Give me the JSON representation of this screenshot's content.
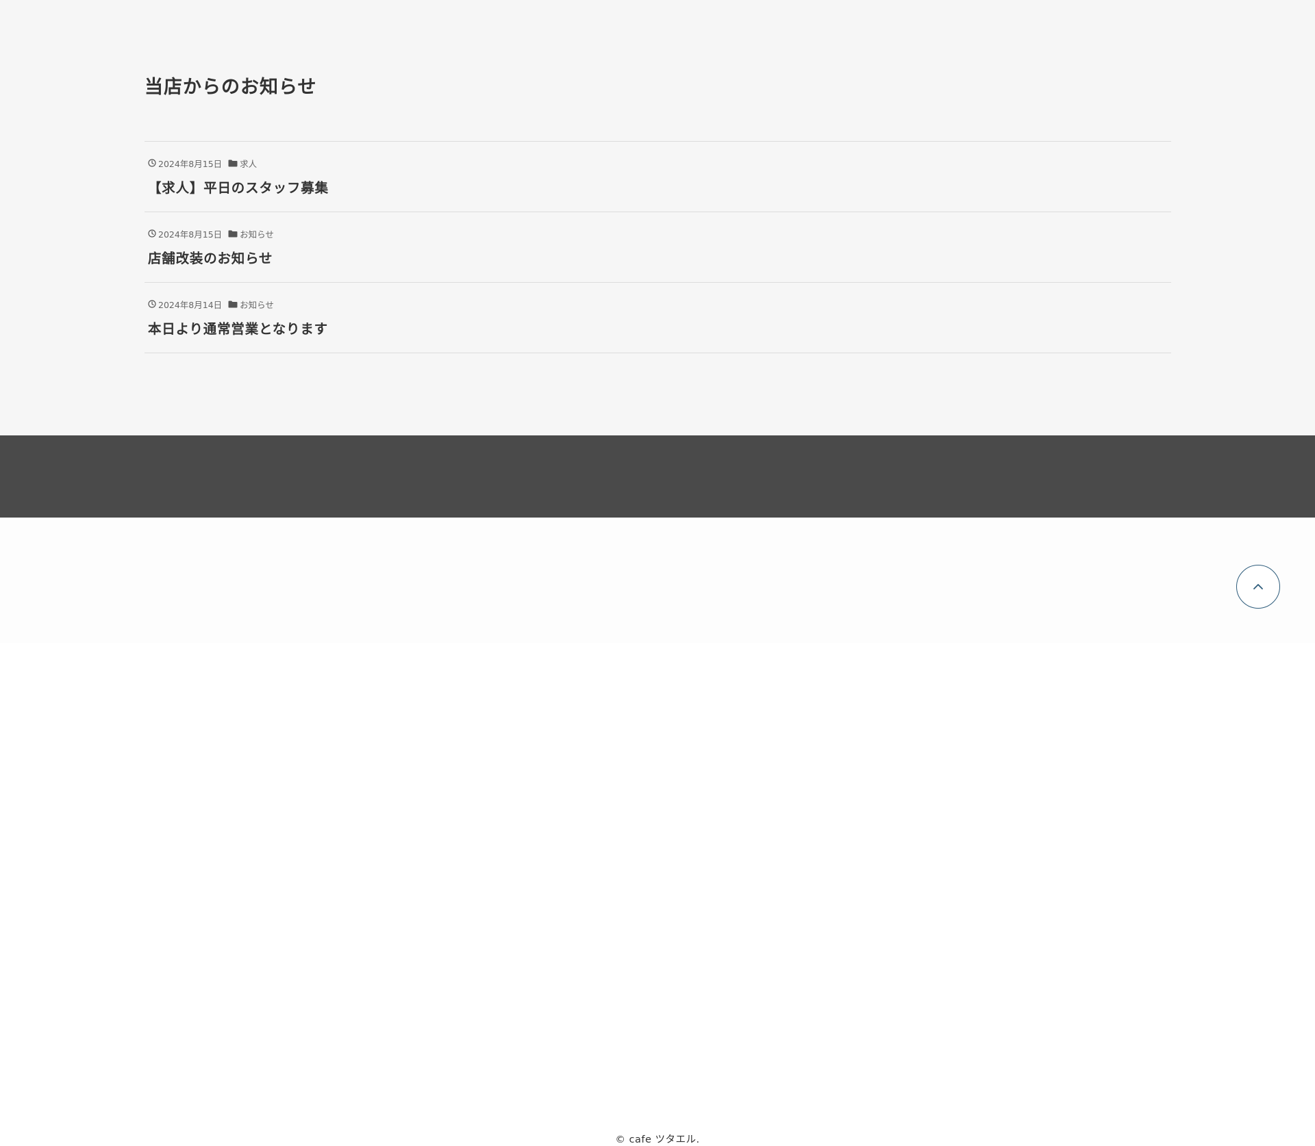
{
  "news": {
    "title": "当店からのお知らせ",
    "items": [
      {
        "date": "2024年8月15日",
        "category": "求人",
        "title": "【求人】平日のスタッフ募集"
      },
      {
        "date": "2024年8月15日",
        "category": "お知らせ",
        "title": "店舗改装のお知らせ"
      },
      {
        "date": "2024年8月14日",
        "category": "お知らせ",
        "title": "本日より通常営業となります"
      }
    ]
  },
  "footer": {
    "copyright": "© cafe ツタエル."
  },
  "icons": {
    "date": "clock-icon",
    "category": "folder-icon",
    "back_to_top": "chevron-up-icon"
  },
  "colors": {
    "section_bg": "#f6f6f6",
    "dark_band": "#4a4a4a",
    "footer_bg": "#fdfdfd",
    "text": "#333333",
    "meta_text": "#666666",
    "back_to_top_border": "#2f5d7c"
  }
}
